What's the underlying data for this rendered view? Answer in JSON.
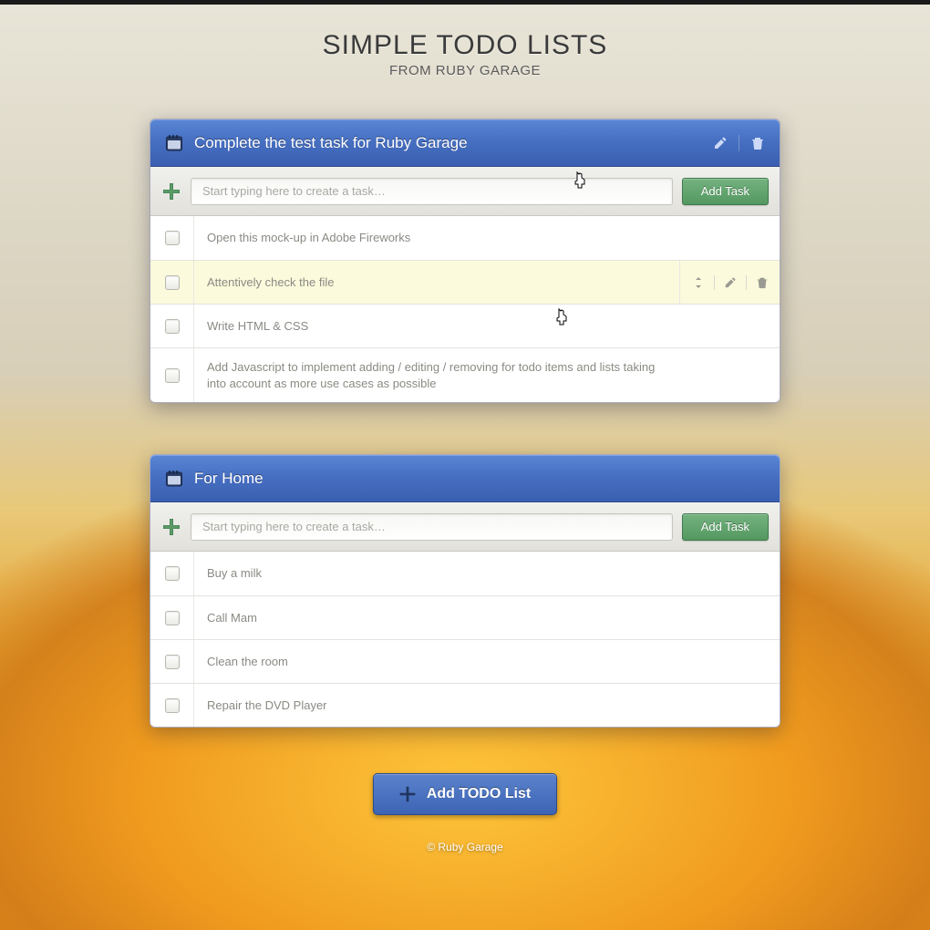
{
  "header": {
    "title": "SIMPLE TODO LISTS",
    "subtitle": "FROM RUBY GARAGE"
  },
  "add_list_label": "Add TODO List",
  "footer": "© Ruby Garage",
  "input_placeholder": "Start typing here to create a task…",
  "add_task_label": "Add Task",
  "lists": [
    {
      "title": "Complete the test task for Ruby Garage",
      "show_header_actions": true,
      "tasks": [
        {
          "text": "Open this mock-up in Adobe Fireworks",
          "hover": false
        },
        {
          "text": "Attentively check the file",
          "hover": true
        },
        {
          "text": "Write HTML & CSS",
          "hover": false
        },
        {
          "text": "Add Javascript to implement adding / editing / removing for todo items and lists taking into account as more use cases as possible",
          "hover": false
        }
      ]
    },
    {
      "title": "For Home",
      "show_header_actions": false,
      "tasks": [
        {
          "text": "Buy a milk",
          "hover": false
        },
        {
          "text": "Call Mam",
          "hover": false
        },
        {
          "text": "Clean the room",
          "hover": false
        },
        {
          "text": "Repair the DVD Player",
          "hover": false
        }
      ]
    }
  ]
}
